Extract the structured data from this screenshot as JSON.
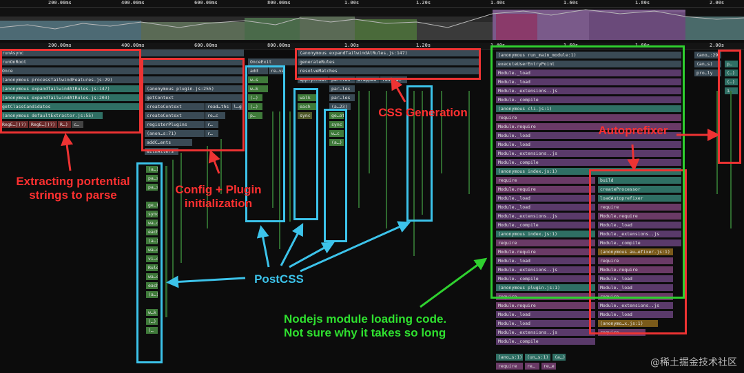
{
  "overview": {
    "ticks": [
      "200.00ms",
      "400.00ms",
      "600.00ms",
      "800.00ms",
      "1.00s",
      "1.20s",
      "1.40s",
      "1.60s",
      "1.80s",
      "2.00s"
    ]
  },
  "ruler": {
    "ticks": [
      "200.00ms",
      "400.00ms",
      "600.00ms",
      "800.00ms",
      "1.00s",
      "1.20s",
      "1.40s",
      "1.60s",
      "1.80s",
      "2.00s"
    ]
  },
  "frames": {
    "left_stack": [
      "runAsync",
      "runOnRoot",
      "Once",
      "(anonymous processTailwindFeatures.js:29)",
      "(anonymous expandTailwindAtRules.js:147)",
      "(anonymous expandTailwindAtRules.js:203)",
      "getClassCandidates",
      "(anonymous defaultExtractor.js:55)"
    ],
    "regex_row": [
      "RegE…])?)",
      "RegE…])?)",
      "R…)",
      "c…"
    ],
    "plugin_stack": [
      "(anonymous plugin.js:255)",
      "getContext",
      "createContext",
      "createContext",
      "registerPlugins",
      "(anon…s:71)",
      "addC…ents",
      "withAlters"
    ],
    "plugin_side": [
      "read…ths",
      "l…g",
      "re…c",
      "r…",
      "r…"
    ],
    "onceexit": [
      "OnceExit",
      "add",
      "re…ve",
      "w…s",
      "w…k",
      "(…)",
      "(…)",
      "p…"
    ],
    "generation": [
      "(anonymous expandTailwindAtRules.js:147)",
      "generateRules",
      "resolveMatches"
    ],
    "generation_sub": [
      "apply…rmat",
      "par…les",
      "wrapped",
      "res…ra…",
      "par…les",
      "par…les",
      "walk",
      "each",
      "(a…23)",
      "sync"
    ],
    "postcss_col": [
      "(a…)",
      "pa…s",
      "pa…s",
      "ge…t",
      "sync",
      "wa…c",
      "each",
      "(a…)",
      "wa…c",
      "vi…c",
      "Rule",
      "wa…c",
      "each",
      "(a…)",
      "w…k",
      "(…)",
      "(…"
    ],
    "postcss_col2": [
      "ge…ot",
      "sync",
      "w…c",
      "(a…)"
    ],
    "node_stack": [
      "(anonymous run_main_module:1)",
      "executeUserEntryPoint",
      "Module._load",
      "Module._load",
      "Module._extensions..js",
      "Module._compile",
      "(anonymous cli.js:1)",
      "require",
      "Module.require",
      "Module._load",
      "Module._load",
      "Module._extensions..js",
      "Module._compile",
      "(anonymous index.js:1)",
      "require",
      "Module.require",
      "Module._load",
      "Module._load",
      "Module._extensions..js",
      "Module._compile",
      "(anonymous index.js:1)",
      "require",
      "Module.require",
      "Module._load",
      "Module._extensions..js",
      "Module._compile",
      "(anonymous plugin.js:1)",
      "require",
      "Module.require",
      "Module._load",
      "Module._load",
      "Module._extensions..js",
      "Module._compile",
      "(ano…s:1)"
    ],
    "autoprefixer_stack": [
      "build",
      "createProcessor",
      "loadAutoprefixer",
      "require",
      "Module.require",
      "Module._load",
      "Module._extensions..js",
      "Module._compile",
      "(anonymous au…efixer.js:1)",
      "require",
      "Module.require",
      "Module._load",
      "Module._load",
      "require",
      "Module._extensions..js",
      "Module._load",
      "(anonymo…x.js:1)",
      "require"
    ],
    "node_bottom_row": [
      "(un…s:1)",
      "(a…)"
    ],
    "node_last_row": [
      "require",
      "re…",
      "re…e"
    ],
    "right_stack": [
      "(ano…:29)",
      "(an…s)",
      "pro…ly"
    ],
    "right_side": [
      "p…",
      "(…)",
      "(…)",
      "1…"
    ]
  },
  "annotations": {
    "extracting": "Extracting portential\nstrings to parse",
    "config": "Config + Plugin\ninitialization",
    "postcss": "PostCSS",
    "css_generation": "CSS Generation",
    "autoprefixer": "Autoprefixer",
    "nodejs": "Nodejs module loading code.\nNot sure why it takes so long"
  },
  "watermark": "@稀土掘金技术社区",
  "colors": {
    "red": "#e33",
    "blue": "#3cc3ea",
    "green": "#2fd12f"
  }
}
